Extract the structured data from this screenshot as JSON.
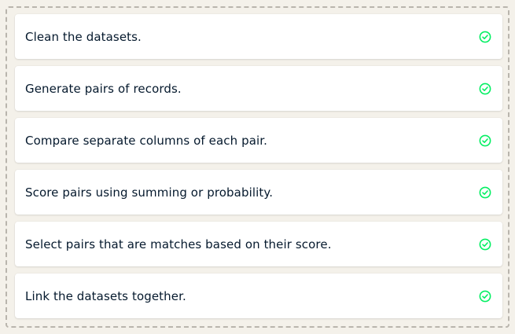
{
  "items": [
    {
      "label": "Clean the datasets.",
      "status_icon": "check-circle-icon"
    },
    {
      "label": "Generate pairs of records.",
      "status_icon": "check-circle-icon"
    },
    {
      "label": "Compare separate columns of each pair.",
      "status_icon": "check-circle-icon"
    },
    {
      "label": "Score pairs using summing or probability.",
      "status_icon": "check-circle-icon"
    },
    {
      "label": "Select pairs that are matches based on their score.",
      "status_icon": "check-circle-icon"
    },
    {
      "label": "Link the datasets together.",
      "status_icon": "check-circle-icon"
    }
  ],
  "colors": {
    "background": "#f4f1ea",
    "card": "#ffffff",
    "text": "#05192d",
    "check": "#03ef62",
    "dashed_border": "#b9b5ad"
  }
}
